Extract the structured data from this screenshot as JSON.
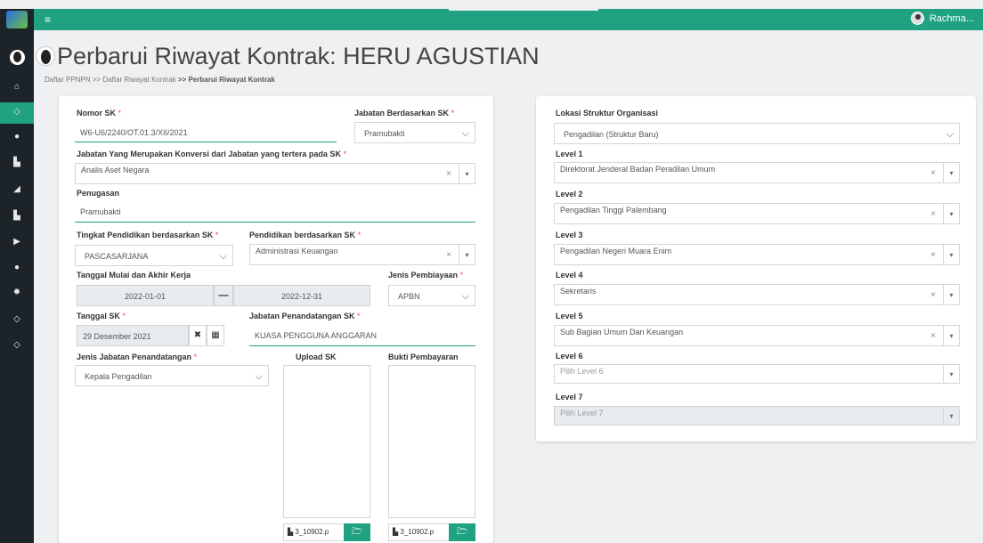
{
  "header": {
    "menu_icon": "≡",
    "user_name": "Rachma..."
  },
  "page": {
    "title": "Perbarui Riwayat Kontrak: HERU AGUSTIAN"
  },
  "breadcrumb": {
    "item1": "Daftar PPNPN",
    "sep": ">>",
    "item2": "Daftar Riwayat Kontrak",
    "item3": "Perbarui Riwayat Kontrak"
  },
  "form": {
    "nomor_sk": {
      "label": "Nomor SK",
      "value": "W6-U6/2240/OT.01.3/XII/2021"
    },
    "jabatan_sk": {
      "label": "Jabatan Berdasarkan SK",
      "value": "Pramubakti"
    },
    "jabatan_konversi": {
      "label": "Jabatan Yang Merupakan Konversi dari Jabatan yang tertera pada SK",
      "value": "Analis Aset Negara"
    },
    "penugasan": {
      "label": "Penugasan",
      "value": "Pramubakti"
    },
    "tingkat_pendidikan": {
      "label": "Tingkat Pendidikan berdasarkan SK",
      "value": "PASCASARJANA"
    },
    "pendidikan": {
      "label": "Pendidikan berdasarkan SK",
      "value": "Administrasi Keuangan"
    },
    "tanggal_kerja": {
      "label": "Tanggal Mulai dan Akhir Kerja",
      "start": "2022-01-01",
      "separator": "—",
      "end": "2022-12-31"
    },
    "jenis_pembiayaan": {
      "label": "Jenis Pembiayaan",
      "value": "APBN"
    },
    "tanggal_sk": {
      "label": "Tanggal SK",
      "value": "29 Desember 2021"
    },
    "jabatan_penandatangan": {
      "label": "Jabatan Penandatangan SK",
      "value": "KUASA PENGGUNA ANGGARAN"
    },
    "jenis_jabatan_penandatangan": {
      "label": "Jenis Jabatan Penandatangan",
      "value": "Kepala Pengadilan"
    },
    "upload_sk": {
      "label": "Upload SK",
      "filename": "3_10902.p"
    },
    "bukti_pembayaran": {
      "label": "Bukti Pembayaran",
      "filename": "3_10902.p"
    }
  },
  "org": {
    "lokasi": {
      "label": "Lokasi Struktur Organisasi",
      "value": "Pengadilan (Struktur Baru)"
    },
    "level1": {
      "label": "Level 1",
      "value": "Direktorat Jenderal Badan Peradilan Umum"
    },
    "level2": {
      "label": "Level 2",
      "value": "Pengadilan Tinggi Palembang"
    },
    "level3": {
      "label": "Level 3",
      "value": "Pengadilan Negeri Muara Enim"
    },
    "level4": {
      "label": "Level 4",
      "value": "Sekretaris"
    },
    "level5": {
      "label": "Level 5",
      "value": "Sub Bagian Umum Dan Keuangan"
    },
    "level6": {
      "label": "Level 6",
      "placeholder": "Pilih Level 6"
    },
    "level7": {
      "label": "Level 7",
      "placeholder": "Pilih Level 7"
    }
  },
  "symbols": {
    "required": "*",
    "clear": "×",
    "chevron": "⌵",
    "select2_arrow": "▾",
    "clear_date": "✖",
    "calendar": "▦",
    "folder": "🗁",
    "file": "▙"
  },
  "colors": {
    "accent": "#1fa182",
    "sidebar": "#1d2429",
    "required": "#e74c3c"
  }
}
